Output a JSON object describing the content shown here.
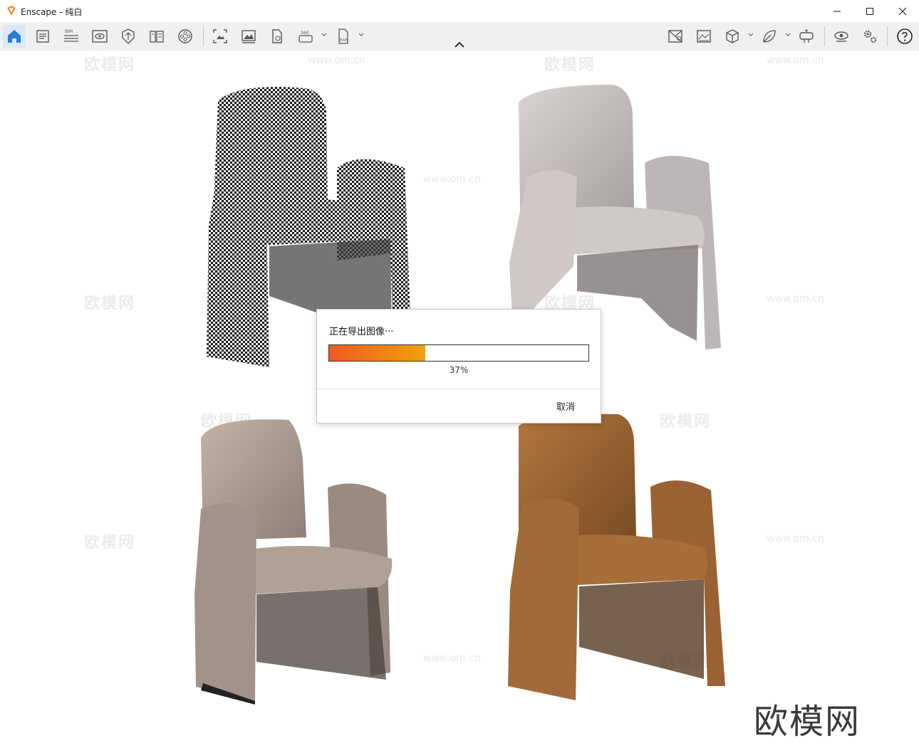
{
  "window": {
    "app_name": "Enscape",
    "title": "Enscape - 纯白"
  },
  "toolbar": {
    "left_icons": [
      "home-icon",
      "assets-icon",
      "bim-icon",
      "view-icon",
      "material-icon",
      "library-icon",
      "video-icon"
    ],
    "middle_icons": [
      "screenshot-icon",
      "batch-render-icon",
      "panorama-icon",
      "360-icon",
      "exe-export-icon"
    ],
    "bim_label": "BIM",
    "label_360": "360",
    "exe_label": "EXE",
    "right_icons": [
      "site-context-icon",
      "atmosphere-icon",
      "cube-icon",
      "leaf-icon",
      "vr-headset-icon",
      "visual-settings-icon",
      "settings-icon",
      "help-icon"
    ]
  },
  "dialog": {
    "message": "正在导出图像···",
    "progress": 0.37,
    "progress_text": "37%",
    "cancel_label": "取消",
    "accent_start": "#ef5a23",
    "accent_end": "#f0a10c"
  },
  "watermark": {
    "text": "欧模网",
    "url": "www.om.cn"
  }
}
